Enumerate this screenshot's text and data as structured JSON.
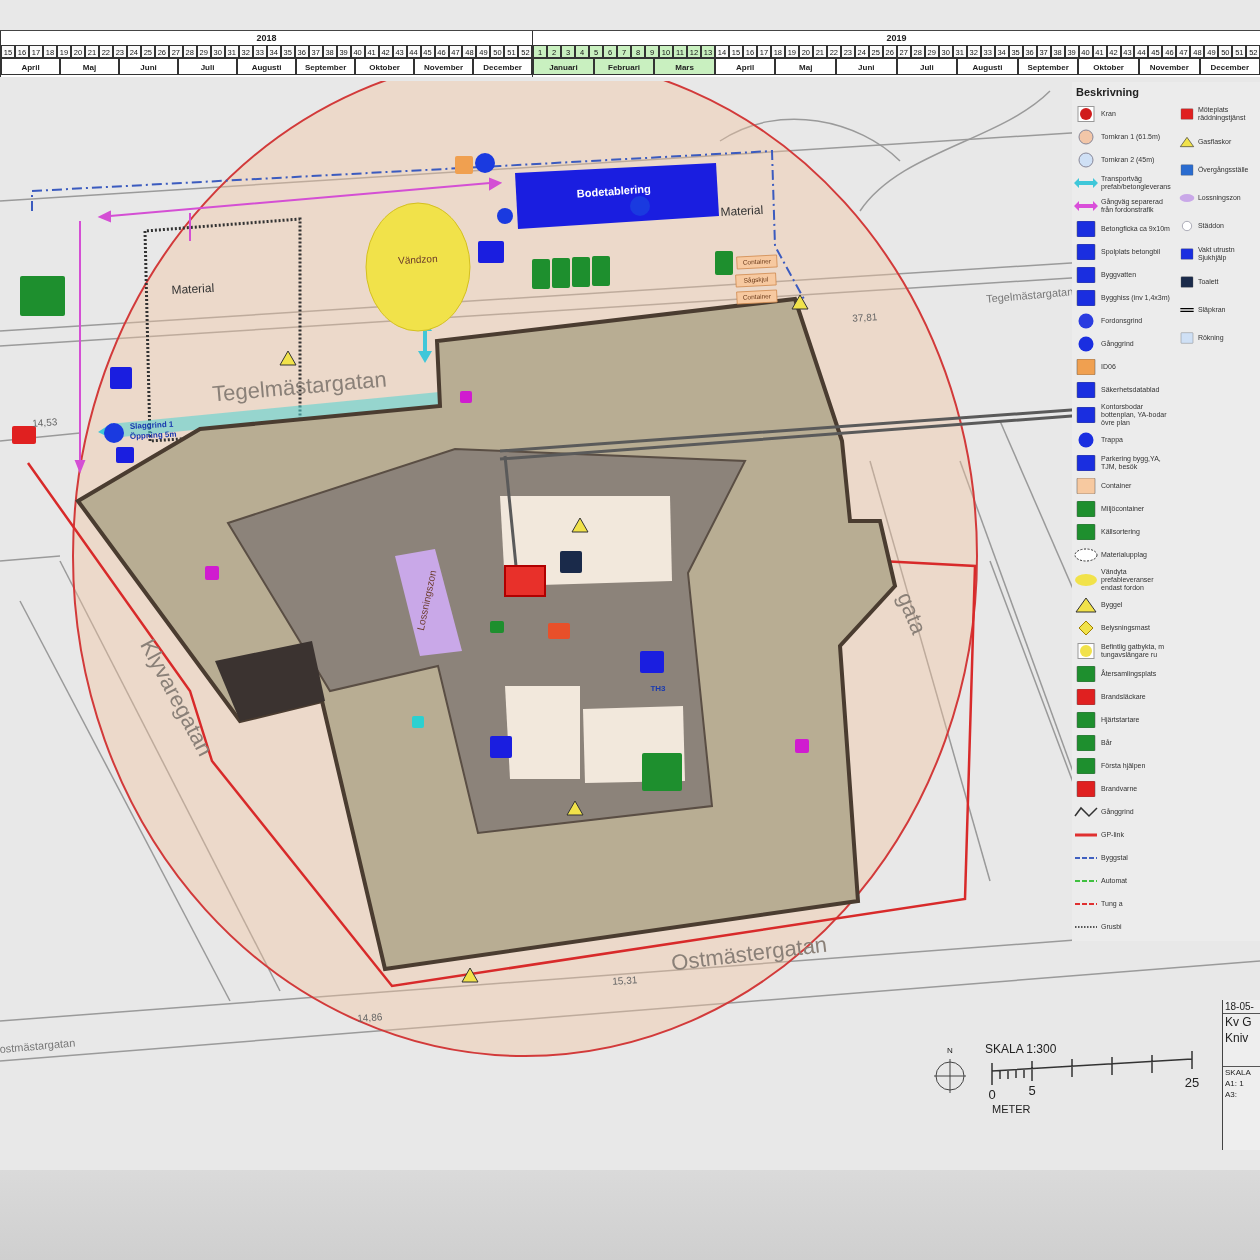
{
  "timeline": {
    "years": [
      {
        "label": "2018",
        "weeks": [
          {
            "label": "15",
            "highlighted": false
          },
          {
            "label": "16",
            "highlighted": false
          },
          {
            "label": "17",
            "highlighted": false
          },
          {
            "label": "18",
            "highlighted": false
          },
          {
            "label": "19",
            "highlighted": false
          },
          {
            "label": "20",
            "highlighted": false
          },
          {
            "label": "21",
            "highlighted": false
          },
          {
            "label": "22",
            "highlighted": false
          },
          {
            "label": "23",
            "highlighted": false
          },
          {
            "label": "24",
            "highlighted": false
          },
          {
            "label": "25",
            "highlighted": false
          },
          {
            "label": "26",
            "highlighted": false
          },
          {
            "label": "27",
            "highlighted": false
          },
          {
            "label": "28",
            "highlighted": false
          },
          {
            "label": "29",
            "highlighted": false
          },
          {
            "label": "30",
            "highlighted": false
          },
          {
            "label": "31",
            "highlighted": false
          },
          {
            "label": "32",
            "highlighted": false
          },
          {
            "label": "33",
            "highlighted": false
          },
          {
            "label": "34",
            "highlighted": false
          },
          {
            "label": "35",
            "highlighted": false
          },
          {
            "label": "36",
            "highlighted": false
          },
          {
            "label": "37",
            "highlighted": false
          },
          {
            "label": "38",
            "highlighted": false
          },
          {
            "label": "39",
            "highlighted": false
          },
          {
            "label": "40",
            "highlighted": false
          },
          {
            "label": "41",
            "highlighted": false
          },
          {
            "label": "42",
            "highlighted": false
          },
          {
            "label": "43",
            "highlighted": false
          },
          {
            "label": "44",
            "highlighted": false
          },
          {
            "label": "45",
            "highlighted": false
          },
          {
            "label": "46",
            "highlighted": false
          },
          {
            "label": "47",
            "highlighted": false
          },
          {
            "label": "48",
            "highlighted": false
          },
          {
            "label": "49",
            "highlighted": false
          },
          {
            "label": "50",
            "highlighted": false
          },
          {
            "label": "51",
            "highlighted": false
          },
          {
            "label": "52",
            "highlighted": false
          }
        ],
        "months": [
          {
            "label": "April",
            "highlighted": false
          },
          {
            "label": "Maj",
            "highlighted": false
          },
          {
            "label": "Juni",
            "highlighted": false
          },
          {
            "label": "Juli",
            "highlighted": false
          },
          {
            "label": "Augusti",
            "highlighted": false
          },
          {
            "label": "September",
            "highlighted": false
          },
          {
            "label": "Oktober",
            "highlighted": false
          },
          {
            "label": "November",
            "highlighted": false
          },
          {
            "label": "December",
            "highlighted": false
          }
        ]
      },
      {
        "label": "2019",
        "weeks": [
          {
            "label": "1",
            "highlighted": true
          },
          {
            "label": "2",
            "highlighted": true
          },
          {
            "label": "3",
            "highlighted": true
          },
          {
            "label": "4",
            "highlighted": true
          },
          {
            "label": "5",
            "highlighted": true
          },
          {
            "label": "6",
            "highlighted": true
          },
          {
            "label": "7",
            "highlighted": true
          },
          {
            "label": "8",
            "highlighted": true
          },
          {
            "label": "9",
            "highlighted": true
          },
          {
            "label": "10",
            "highlighted": true
          },
          {
            "label": "11",
            "highlighted": true
          },
          {
            "label": "12",
            "highlighted": true
          },
          {
            "label": "13",
            "highlighted": true
          },
          {
            "label": "14",
            "highlighted": false
          },
          {
            "label": "15",
            "highlighted": false
          },
          {
            "label": "16",
            "highlighted": false
          },
          {
            "label": "17",
            "highlighted": false
          },
          {
            "label": "18",
            "highlighted": false
          },
          {
            "label": "19",
            "highlighted": false
          },
          {
            "label": "20",
            "highlighted": false
          },
          {
            "label": "21",
            "highlighted": false
          },
          {
            "label": "22",
            "highlighted": false
          },
          {
            "label": "23",
            "highlighted": false
          },
          {
            "label": "24",
            "highlighted": false
          },
          {
            "label": "25",
            "highlighted": false
          },
          {
            "label": "26",
            "highlighted": false
          },
          {
            "label": "27",
            "highlighted": false
          },
          {
            "label": "28",
            "highlighted": false
          },
          {
            "label": "29",
            "highlighted": false
          },
          {
            "label": "30",
            "highlighted": false
          },
          {
            "label": "31",
            "highlighted": false
          },
          {
            "label": "32",
            "highlighted": false
          },
          {
            "label": "33",
            "highlighted": false
          },
          {
            "label": "34",
            "highlighted": false
          },
          {
            "label": "35",
            "highlighted": false
          },
          {
            "label": "36",
            "highlighted": false
          },
          {
            "label": "37",
            "highlighted": false
          },
          {
            "label": "38",
            "highlighted": false
          },
          {
            "label": "39",
            "highlighted": false
          },
          {
            "label": "40",
            "highlighted": false
          },
          {
            "label": "41",
            "highlighted": false
          },
          {
            "label": "42",
            "highlighted": false
          },
          {
            "label": "43",
            "highlighted": false
          },
          {
            "label": "44",
            "highlighted": false
          },
          {
            "label": "45",
            "highlighted": false
          },
          {
            "label": "46",
            "highlighted": false
          },
          {
            "label": "47",
            "highlighted": false
          },
          {
            "label": "48",
            "highlighted": false
          },
          {
            "label": "49",
            "highlighted": false
          },
          {
            "label": "50",
            "highlighted": false
          },
          {
            "label": "51",
            "highlighted": false
          },
          {
            "label": "52",
            "highlighted": false
          }
        ],
        "months": [
          {
            "label": "Januari",
            "highlighted": true
          },
          {
            "label": "Februari",
            "highlighted": true
          },
          {
            "label": "Mars",
            "highlighted": true
          },
          {
            "label": "April",
            "highlighted": false
          },
          {
            "label": "Maj",
            "highlighted": false
          },
          {
            "label": "Juni",
            "highlighted": false
          },
          {
            "label": "Juli",
            "highlighted": false
          },
          {
            "label": "Augusti",
            "highlighted": false
          },
          {
            "label": "September",
            "highlighted": false
          },
          {
            "label": "Oktober",
            "highlighted": false
          },
          {
            "label": "November",
            "highlighted": false
          },
          {
            "label": "December",
            "highlighted": false
          }
        ]
      }
    ]
  },
  "site_plan": {
    "labels": [
      {
        "text": "Material",
        "kind": "area"
      },
      {
        "text": "Material",
        "kind": "area"
      },
      {
        "text": "Vändzon",
        "kind": "zone"
      },
      {
        "text": "Bodetablering",
        "kind": "banner"
      },
      {
        "text": "Container",
        "kind": "tag"
      },
      {
        "text": "Sågskjul",
        "kind": "tag"
      },
      {
        "text": "Container",
        "kind": "tag"
      },
      {
        "text": "Tegelmästargatan",
        "kind": "street"
      },
      {
        "text": "Tegelmästargatan",
        "kind": "minor-street"
      },
      {
        "text": "Slaggrind 1",
        "kind": "note"
      },
      {
        "text": "Öppning 5m",
        "kind": "note"
      },
      {
        "text": "14,53",
        "kind": "elevation"
      },
      {
        "text": "37,81",
        "kind": "elevation"
      },
      {
        "text": "Lossningszon",
        "kind": "zone"
      },
      {
        "text": "TH3",
        "kind": "note"
      },
      {
        "text": "Klyvaregatan",
        "kind": "street"
      },
      {
        "text": "gata",
        "kind": "street"
      },
      {
        "text": "Ostmästergatan",
        "kind": "street"
      },
      {
        "text": "ostmästargatan",
        "kind": "minor-street"
      },
      {
        "text": "15,31",
        "kind": "elevation"
      },
      {
        "text": "14,86",
        "kind": "elevation"
      }
    ]
  },
  "legend": {
    "title": "Beskrivning",
    "items": [
      {
        "label": "Kran",
        "kind": "framed-dot",
        "color": "#d01c1c"
      },
      {
        "label": "Tornkran 1 (61.5m)",
        "kind": "circle",
        "color": "#f2c6a8"
      },
      {
        "label": "Tornkran 2 (45m)",
        "kind": "circle",
        "color": "#cfe0f5"
      },
      {
        "label": "Transportväg prefab/betongleverans",
        "kind": "arrow",
        "color": "#3fc7d9"
      },
      {
        "label": "Gångväg separerad från fordonstrafik",
        "kind": "arrow",
        "color": "#d94fd9"
      },
      {
        "label": "Betongficka ca 9x10m",
        "kind": "sign",
        "color": "#1a2ee0"
      },
      {
        "label": "Spolplats betongbil",
        "kind": "sign",
        "color": "#1a2ee0"
      },
      {
        "label": "Byggvatten",
        "kind": "sign",
        "color": "#1a2ee0"
      },
      {
        "label": "Bygghiss (inv 1,4x3m)",
        "kind": "sign",
        "color": "#1a2ee0"
      },
      {
        "label": "Fordonsgrind",
        "kind": "round",
        "color": "#2a3ce0"
      },
      {
        "label": "Gånggrind",
        "kind": "round",
        "color": "#1a2ee0"
      },
      {
        "label": "ID06",
        "kind": "sign",
        "color": "#f0a050"
      },
      {
        "label": "Säkerhetsdatablad",
        "kind": "sign",
        "color": "#1a2ee0"
      },
      {
        "label": "Kontorsbodar bottenplan, YA-bodar övre plan",
        "kind": "sign",
        "color": "#1a2ee0"
      },
      {
        "label": "Trappa",
        "kind": "round",
        "color": "#1a2ee0"
      },
      {
        "label": "Parkering bygg,YA, TJM, besök",
        "kind": "sign",
        "color": "#1a2ee0"
      },
      {
        "label": "Container",
        "kind": "sign",
        "color": "#f7c9a0"
      },
      {
        "label": "Miljöcontainer",
        "kind": "sign",
        "color": "#1e8f2e"
      },
      {
        "label": "Källsortering",
        "kind": "sign",
        "color": "#1e8f2e"
      },
      {
        "label": "Materialupplag",
        "kind": "dashed-ellipse",
        "color": "#ffffff"
      },
      {
        "label": "Vändyta prefableveranser endast fordon",
        "kind": "hatched-ellipse",
        "color": "#f1e24a"
      },
      {
        "label": "Byggel",
        "kind": "triangle",
        "color": "#f1e24a"
      },
      {
        "label": "Belysningsmast",
        "kind": "diamond",
        "color": "#f1e24a"
      },
      {
        "label": "Befintlig gatbykta, m tungavslängare ru",
        "kind": "framed-dot",
        "color": "#f1e24a"
      },
      {
        "label": "Återsamlingsplats",
        "kind": "sign",
        "color": "#1e8f2e"
      },
      {
        "label": "Brandsläckare",
        "kind": "sign",
        "color": "#e02020"
      },
      {
        "label": "Hjärtstartare",
        "kind": "sign",
        "color": "#1e8f2e"
      },
      {
        "label": "Bår",
        "kind": "sign",
        "color": "#1e8f2e"
      },
      {
        "label": "Första hjälpen",
        "kind": "sign",
        "color": "#1e8f2e"
      },
      {
        "label": "Brandvarne",
        "kind": "sign",
        "color": "#e02020"
      },
      {
        "label": "Gånggrind",
        "kind": "zigzag",
        "color": "#333333"
      },
      {
        "label": "GP-link",
        "kind": "line",
        "color": "#e03030"
      },
      {
        "label": "Byggstal",
        "kind": "dashed-line",
        "color": "#4060c0"
      },
      {
        "label": "Automat",
        "kind": "dashed-line",
        "color": "#40c040"
      },
      {
        "label": "Tung a",
        "kind": "dashed-line",
        "color": "#e03030"
      },
      {
        "label": "Grusbi",
        "kind": "dotted-line",
        "color": "#555555"
      }
    ],
    "side_items": [
      {
        "label": "Möteplats räddningstjänst",
        "kind": "sign",
        "color": "#e02020"
      },
      {
        "label": "Gasflaskor",
        "kind": "triangle",
        "color": "#f1e24a"
      },
      {
        "label": "Övergångsställe",
        "kind": "sign",
        "color": "#2a6cd0"
      },
      {
        "label": "Lossningszon",
        "kind": "hatched-ellipse",
        "color": "#c9a8e8"
      },
      {
        "label": "Städdon",
        "kind": "circle",
        "color": "#ffffff"
      },
      {
        "label": "Vakt utrustn Sjukhjälp",
        "kind": "sign",
        "color": "#1a2ee0"
      },
      {
        "label": "Toalett",
        "kind": "sign",
        "color": "#1a2a4a"
      },
      {
        "label": "Släpkran",
        "kind": "double-line",
        "color": "#000000"
      },
      {
        "label": "Rökning",
        "kind": "sign",
        "color": "#cfe0f5"
      }
    ]
  },
  "scale": {
    "title": "SKALA 1:300",
    "ticks": [
      "0",
      "5",
      "25"
    ],
    "unit": "METER",
    "north": "N"
  },
  "title_block": {
    "fields": [
      "18-05-",
      "Kv G",
      "Kniv",
      "SKALA",
      "A1: 1",
      "A3:"
    ]
  }
}
